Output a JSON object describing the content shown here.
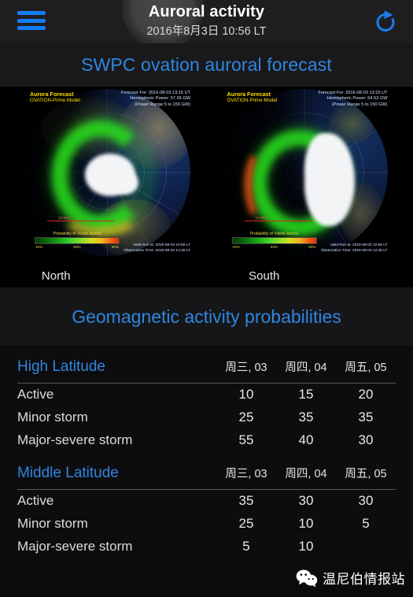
{
  "header": {
    "title": "Auroral activity",
    "datetime": "2016年8月3日 10:56 LT",
    "menu_icon": "hamburger-menu-icon",
    "refresh_icon": "refresh-icon"
  },
  "swpc": {
    "title": "SWPC ovation auroral forecast"
  },
  "aurora": {
    "panels": [
      {
        "hemisphere": "North",
        "cap_title": "Aurora Forecast",
        "cap_model": "OVATION-Prime Model",
        "forecast_for": "Forecast For: 2016-08-03 13:15 UT",
        "hemispheric_power": "Hemispheric Power: 57.55 GW",
        "power_range": "(Power Range 5 to 150 GW)",
        "mlt_label": "12 MLT",
        "colorbar_title": "Probability of Visible Aurora",
        "colorbar_ticks": [
          "10%",
          "50%",
          "90%"
        ],
        "footer_line1": "Valid Run at: 2016-08-03 10:56 LT",
        "footer_line2": "Observation Time: 2016-08-03 12:45 LT"
      },
      {
        "hemisphere": "South",
        "cap_title": "Aurora Forecast",
        "cap_model": "OVATION-Prime Model",
        "forecast_for": "Forecast For: 2016-08-03 13:15 UT",
        "hemispheric_power": "Hemispheric Power: 54.53 GW",
        "power_range": "(Power Range 5 to 150 GW)",
        "mlt_label": "12 MLT",
        "colorbar_title": "Probability of Visible Aurora",
        "colorbar_ticks": [
          "10%",
          "50%",
          "90%"
        ],
        "footer_line1": "Valid Run at: 2016-08-03 10:56 LT",
        "footer_line2": "Observation Time: 2016-08-03 12:45 LT"
      }
    ]
  },
  "geomagnetic": {
    "title": "Geomagnetic activity probabilities",
    "groups": [
      {
        "name": "High Latitude",
        "columns": [
          "周三, 03",
          "周四, 04",
          "周五, 05"
        ],
        "rows": [
          {
            "label": "Active",
            "values": [
              "10",
              "15",
              "20"
            ]
          },
          {
            "label": "Minor storm",
            "values": [
              "25",
              "35",
              "35"
            ]
          },
          {
            "label": "Major-severe storm",
            "values": [
              "55",
              "40",
              "30"
            ]
          }
        ]
      },
      {
        "name": "Middle Latitude",
        "columns": [
          "周三, 03",
          "周四, 04",
          "周五, 05"
        ],
        "rows": [
          {
            "label": "Active",
            "values": [
              "35",
              "30",
              "30"
            ]
          },
          {
            "label": "Minor storm",
            "values": [
              "25",
              "10",
              "5"
            ]
          },
          {
            "label": "Major-severe storm",
            "values": [
              "5",
              "10",
              ""
            ]
          }
        ]
      }
    ]
  },
  "watermark": {
    "text": "温尼伯情报站",
    "icon": "wechat-icon"
  },
  "colors": {
    "accent_blue": "#2f86e0",
    "icon_blue": "#127ef0",
    "topbar_bg": "#1e1e20",
    "panel_bg": "#0d0d0f"
  }
}
